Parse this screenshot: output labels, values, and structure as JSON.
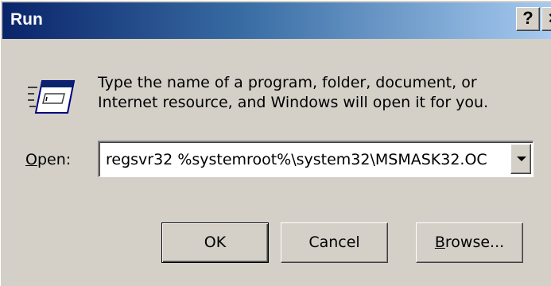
{
  "window": {
    "title": "Run",
    "help_glyph": "?",
    "close_glyph": "×",
    "titlebar_colors": [
      "#0a246a",
      "#a6caf0"
    ]
  },
  "icon": {
    "name": "run-icon"
  },
  "description": "Type the name of a program, folder, document, or Internet resource, and Windows will open it for you.",
  "open": {
    "mnemonic": "O",
    "label_rest": "pen:",
    "value": "regsvr32 %systemroot%\\system32\\MSMASK32.OC"
  },
  "buttons": {
    "ok": "OK",
    "cancel": "Cancel",
    "browse_mnemonic": "B",
    "browse_rest": "rowse..."
  }
}
